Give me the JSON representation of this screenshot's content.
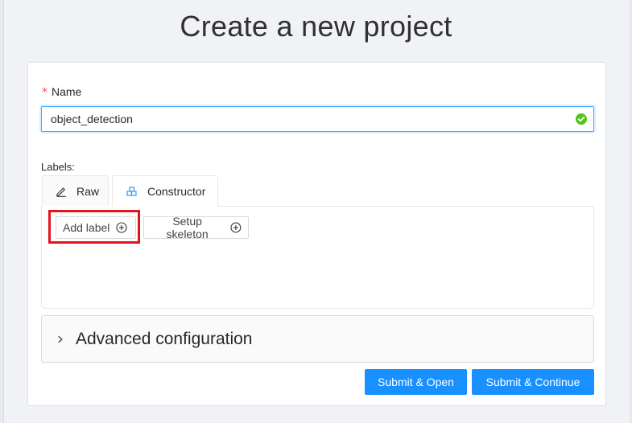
{
  "page": {
    "title": "Create a new project"
  },
  "form": {
    "name": {
      "required_mark": "*",
      "label": "Name",
      "value": "object_detection",
      "status": "valid",
      "status_icon": "check-circle-icon",
      "status_color": "#52c41a"
    },
    "labels": {
      "label": "Labels:",
      "tabs": [
        {
          "label": "Raw",
          "icon": "edit-icon",
          "active": false
        },
        {
          "label": "Constructor",
          "icon": "build-icon",
          "active": true
        }
      ],
      "buttons": {
        "add_label": "Add label",
        "setup_skeleton": "Setup skeleton"
      },
      "highlighted_button": "add_label"
    },
    "advanced": {
      "label": "Advanced configuration",
      "expanded": false
    },
    "actions": {
      "submit_open": "Submit & Open",
      "submit_continue": "Submit & Continue"
    }
  },
  "colors": {
    "primary": "#1890ff",
    "highlight": "#e3141c",
    "required": "#ff4d4f",
    "valid": "#52c41a"
  }
}
